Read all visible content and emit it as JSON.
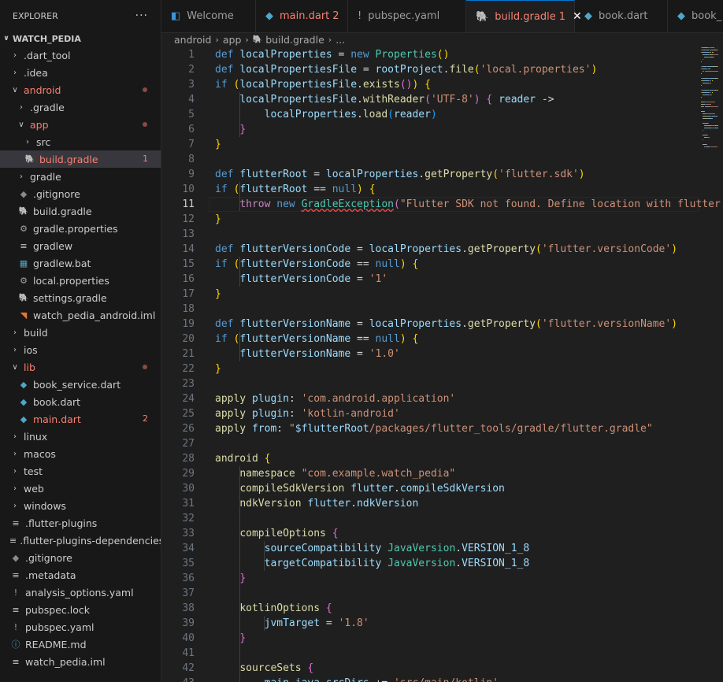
{
  "explorer": {
    "title": "EXPLORER",
    "more": "···",
    "root": "WATCH_PEDIA"
  },
  "tree": [
    {
      "label": ".dart_tool",
      "icon": "chevron-right",
      "level": 1,
      "kind": "folder"
    },
    {
      "label": ".idea",
      "icon": "chevron-right",
      "level": 1,
      "kind": "folder"
    },
    {
      "label": "android",
      "icon": "chevron-down",
      "level": 1,
      "kind": "folder",
      "red": true,
      "dot": true
    },
    {
      "label": ".gradle",
      "icon": "chevron-right",
      "level": 2,
      "kind": "folder"
    },
    {
      "label": "app",
      "icon": "chevron-down",
      "level": 2,
      "kind": "folder",
      "red": true,
      "dot": true
    },
    {
      "label": "src",
      "icon": "chevron-right",
      "level": 3,
      "kind": "folder"
    },
    {
      "label": "build.gradle",
      "icon": "gradle-icon",
      "level": 3,
      "kind": "file",
      "red": true,
      "selected": true,
      "count": "1"
    },
    {
      "label": "gradle",
      "icon": "chevron-right",
      "level": 2,
      "kind": "folder"
    },
    {
      "label": ".gitignore",
      "icon": "git-icon",
      "level": 2,
      "kind": "file"
    },
    {
      "label": "build.gradle",
      "icon": "gradle-icon",
      "level": 2,
      "kind": "file"
    },
    {
      "label": "gradle.properties",
      "icon": "gear-icon",
      "level": 2,
      "kind": "file"
    },
    {
      "label": "gradlew",
      "icon": "lines-icon",
      "level": 2,
      "kind": "file"
    },
    {
      "label": "gradlew.bat",
      "icon": "windows-icon",
      "level": 2,
      "kind": "file"
    },
    {
      "label": "local.properties",
      "icon": "gear-icon",
      "level": 2,
      "kind": "file"
    },
    {
      "label": "settings.gradle",
      "icon": "gradle-icon",
      "level": 2,
      "kind": "file"
    },
    {
      "label": "watch_pedia_android.iml",
      "icon": "rss-icon",
      "level": 2,
      "kind": "file"
    },
    {
      "label": "build",
      "icon": "chevron-right",
      "level": 1,
      "kind": "folder"
    },
    {
      "label": "ios",
      "icon": "chevron-right",
      "level": 1,
      "kind": "folder"
    },
    {
      "label": "lib",
      "icon": "chevron-down",
      "level": 1,
      "kind": "folder",
      "red": true,
      "dot": true
    },
    {
      "label": "book_service.dart",
      "icon": "dart-icon",
      "level": 2,
      "kind": "file"
    },
    {
      "label": "book.dart",
      "icon": "dart-icon",
      "level": 2,
      "kind": "file"
    },
    {
      "label": "main.dart",
      "icon": "dart-icon",
      "level": 2,
      "kind": "file",
      "red": true,
      "count": "2"
    },
    {
      "label": "linux",
      "icon": "chevron-right",
      "level": 1,
      "kind": "folder"
    },
    {
      "label": "macos",
      "icon": "chevron-right",
      "level": 1,
      "kind": "folder"
    },
    {
      "label": "test",
      "icon": "chevron-right",
      "level": 1,
      "kind": "folder"
    },
    {
      "label": "web",
      "icon": "chevron-right",
      "level": 1,
      "kind": "folder"
    },
    {
      "label": "windows",
      "icon": "chevron-right",
      "level": 1,
      "kind": "folder"
    },
    {
      "label": ".flutter-plugins",
      "icon": "lines-icon",
      "level": 1,
      "kind": "file"
    },
    {
      "label": ".flutter-plugins-dependencies",
      "icon": "lines-icon",
      "level": 1,
      "kind": "file"
    },
    {
      "label": ".gitignore",
      "icon": "git-icon",
      "level": 1,
      "kind": "file"
    },
    {
      "label": ".metadata",
      "icon": "lines-icon",
      "level": 1,
      "kind": "file"
    },
    {
      "label": "analysis_options.yaml",
      "icon": "exclamation-icon",
      "level": 1,
      "kind": "file"
    },
    {
      "label": "pubspec.lock",
      "icon": "lines-icon",
      "level": 1,
      "kind": "file"
    },
    {
      "label": "pubspec.yaml",
      "icon": "exclamation-icon",
      "level": 1,
      "kind": "file"
    },
    {
      "label": "README.md",
      "icon": "info-icon",
      "level": 1,
      "kind": "file"
    },
    {
      "label": "watch_pedia.iml",
      "icon": "lines-icon",
      "level": 1,
      "kind": "file"
    }
  ],
  "tabs": [
    {
      "label": "Welcome",
      "icon": "vscode-icon"
    },
    {
      "label": "main.dart",
      "icon": "dart-icon",
      "badge": "2",
      "red": true
    },
    {
      "label": "pubspec.yaml",
      "icon": "exclamation-icon"
    },
    {
      "label": "build.gradle",
      "icon": "gradle-icon",
      "badge": "1",
      "red": true,
      "active": true,
      "close": "✕"
    },
    {
      "label": "book.dart",
      "icon": "dart-icon"
    },
    {
      "label": "book_",
      "icon": "dart-icon"
    }
  ],
  "breadcrumb": [
    "android",
    "app",
    "build.gradle",
    "..."
  ],
  "editor": {
    "current_line": 11,
    "lines": [
      [
        [
          "kw",
          "def "
        ],
        [
          "var",
          "localProperties"
        ],
        [
          "pl",
          " = "
        ],
        [
          "kw",
          "new "
        ],
        [
          "ty",
          "Properties"
        ],
        [
          "b1",
          "()"
        ]
      ],
      [
        [
          "kw",
          "def "
        ],
        [
          "var",
          "localPropertiesFile"
        ],
        [
          "pl",
          " = "
        ],
        [
          "var",
          "rootProject"
        ],
        [
          "pl",
          "."
        ],
        [
          "fn",
          "file"
        ],
        [
          "b1",
          "("
        ],
        [
          "str",
          "'local.properties'"
        ],
        [
          "b1",
          ")"
        ]
      ],
      [
        [
          "kw",
          "if "
        ],
        [
          "b1",
          "("
        ],
        [
          "var",
          "localPropertiesFile"
        ],
        [
          "pl",
          "."
        ],
        [
          "fn",
          "exists"
        ],
        [
          "b2",
          "()"
        ],
        [
          "b1",
          ")"
        ],
        [
          "pl",
          " "
        ],
        [
          "b1",
          "{"
        ]
      ],
      [
        [
          "pl",
          "    "
        ],
        [
          "var",
          "localPropertiesFile"
        ],
        [
          "pl",
          "."
        ],
        [
          "fn",
          "withReader"
        ],
        [
          "b2",
          "("
        ],
        [
          "str",
          "'UTF-8'"
        ],
        [
          "b2",
          ")"
        ],
        [
          "pl",
          " "
        ],
        [
          "b2",
          "{"
        ],
        [
          "pl",
          " "
        ],
        [
          "var",
          "reader"
        ],
        [
          "pl",
          " ->"
        ]
      ],
      [
        [
          "pl",
          "        "
        ],
        [
          "var",
          "localProperties"
        ],
        [
          "pl",
          "."
        ],
        [
          "fn",
          "load"
        ],
        [
          "b3",
          "("
        ],
        [
          "var",
          "reader"
        ],
        [
          "b3",
          ")"
        ]
      ],
      [
        [
          "pl",
          "    "
        ],
        [
          "b2",
          "}"
        ]
      ],
      [
        [
          "b1",
          "}"
        ]
      ],
      [],
      [
        [
          "kw",
          "def "
        ],
        [
          "var",
          "flutterRoot"
        ],
        [
          "pl",
          " = "
        ],
        [
          "var",
          "localProperties"
        ],
        [
          "pl",
          "."
        ],
        [
          "fn",
          "getProperty"
        ],
        [
          "b1",
          "("
        ],
        [
          "str",
          "'flutter.sdk'"
        ],
        [
          "b1",
          ")"
        ]
      ],
      [
        [
          "kw",
          "if "
        ],
        [
          "b1",
          "("
        ],
        [
          "var",
          "flutterRoot"
        ],
        [
          "pl",
          " == "
        ],
        [
          "kw",
          "null"
        ],
        [
          "b1",
          ")"
        ],
        [
          "pl",
          " "
        ],
        [
          "b1",
          "{"
        ]
      ],
      [
        [
          "pl",
          "    "
        ],
        [
          "ctl",
          "throw "
        ],
        [
          "kw",
          "new "
        ],
        [
          "err",
          "GradleException"
        ],
        [
          "b2",
          "("
        ],
        [
          "str",
          "\"Flutter SDK not found. Define location with flutter.sdk in the local.properties file.\""
        ],
        [
          "b2",
          ")"
        ]
      ],
      [
        [
          "b1",
          "}"
        ]
      ],
      [],
      [
        [
          "kw",
          "def "
        ],
        [
          "var",
          "flutterVersionCode"
        ],
        [
          "pl",
          " = "
        ],
        [
          "var",
          "localProperties"
        ],
        [
          "pl",
          "."
        ],
        [
          "fn",
          "getProperty"
        ],
        [
          "b1",
          "("
        ],
        [
          "str",
          "'flutter.versionCode'"
        ],
        [
          "b1",
          ")"
        ]
      ],
      [
        [
          "kw",
          "if "
        ],
        [
          "b1",
          "("
        ],
        [
          "var",
          "flutterVersionCode"
        ],
        [
          "pl",
          " == "
        ],
        [
          "kw",
          "null"
        ],
        [
          "b1",
          ")"
        ],
        [
          "pl",
          " "
        ],
        [
          "b1",
          "{"
        ]
      ],
      [
        [
          "pl",
          "    "
        ],
        [
          "var",
          "flutterVersionCode"
        ],
        [
          "pl",
          " = "
        ],
        [
          "str",
          "'1'"
        ]
      ],
      [
        [
          "b1",
          "}"
        ]
      ],
      [],
      [
        [
          "kw",
          "def "
        ],
        [
          "var",
          "flutterVersionName"
        ],
        [
          "pl",
          " = "
        ],
        [
          "var",
          "localProperties"
        ],
        [
          "pl",
          "."
        ],
        [
          "fn",
          "getProperty"
        ],
        [
          "b1",
          "("
        ],
        [
          "str",
          "'flutter.versionName'"
        ],
        [
          "b1",
          ")"
        ]
      ],
      [
        [
          "kw",
          "if "
        ],
        [
          "b1",
          "("
        ],
        [
          "var",
          "flutterVersionName"
        ],
        [
          "pl",
          " == "
        ],
        [
          "kw",
          "null"
        ],
        [
          "b1",
          ")"
        ],
        [
          "pl",
          " "
        ],
        [
          "b1",
          "{"
        ]
      ],
      [
        [
          "pl",
          "    "
        ],
        [
          "var",
          "flutterVersionName"
        ],
        [
          "pl",
          " = "
        ],
        [
          "str",
          "'1.0'"
        ]
      ],
      [
        [
          "b1",
          "}"
        ]
      ],
      [],
      [
        [
          "fn",
          "apply "
        ],
        [
          "var",
          "plugin"
        ],
        [
          "pl",
          ": "
        ],
        [
          "str",
          "'com.android.application'"
        ]
      ],
      [
        [
          "fn",
          "apply "
        ],
        [
          "var",
          "plugin"
        ],
        [
          "pl",
          ": "
        ],
        [
          "str",
          "'kotlin-android'"
        ]
      ],
      [
        [
          "fn",
          "apply "
        ],
        [
          "var",
          "from"
        ],
        [
          "pl",
          ": "
        ],
        [
          "str",
          "\""
        ],
        [
          "var",
          "$flutterRoot"
        ],
        [
          "str",
          "/packages/flutter_tools/gradle/flutter.gradle\""
        ]
      ],
      [],
      [
        [
          "fn",
          "android "
        ],
        [
          "b1",
          "{"
        ]
      ],
      [
        [
          "pl",
          "    "
        ],
        [
          "fn",
          "namespace "
        ],
        [
          "str",
          "\"com.example.watch_pedia\""
        ]
      ],
      [
        [
          "pl",
          "    "
        ],
        [
          "fn",
          "compileSdkVersion "
        ],
        [
          "var",
          "flutter"
        ],
        [
          "pl",
          "."
        ],
        [
          "var",
          "compileSdkVersion"
        ]
      ],
      [
        [
          "pl",
          "    "
        ],
        [
          "fn",
          "ndkVersion "
        ],
        [
          "var",
          "flutter"
        ],
        [
          "pl",
          "."
        ],
        [
          "var",
          "ndkVersion"
        ]
      ],
      [],
      [
        [
          "pl",
          "    "
        ],
        [
          "fn",
          "compileOptions "
        ],
        [
          "b2",
          "{"
        ]
      ],
      [
        [
          "pl",
          "        "
        ],
        [
          "var",
          "sourceCompatibility "
        ],
        [
          "ty",
          "JavaVersion"
        ],
        [
          "pl",
          "."
        ],
        [
          "var",
          "VERSION_1_8"
        ]
      ],
      [
        [
          "pl",
          "        "
        ],
        [
          "var",
          "targetCompatibility "
        ],
        [
          "ty",
          "JavaVersion"
        ],
        [
          "pl",
          "."
        ],
        [
          "var",
          "VERSION_1_8"
        ]
      ],
      [
        [
          "pl",
          "    "
        ],
        [
          "b2",
          "}"
        ]
      ],
      [],
      [
        [
          "pl",
          "    "
        ],
        [
          "fn",
          "kotlinOptions "
        ],
        [
          "b2",
          "{"
        ]
      ],
      [
        [
          "pl",
          "        "
        ],
        [
          "var",
          "jvmTarget"
        ],
        [
          "pl",
          " = "
        ],
        [
          "str",
          "'1.8'"
        ]
      ],
      [
        [
          "pl",
          "    "
        ],
        [
          "b2",
          "}"
        ]
      ],
      [],
      [
        [
          "pl",
          "    "
        ],
        [
          "fn",
          "sourceSets "
        ],
        [
          "b2",
          "{"
        ]
      ],
      [
        [
          "pl",
          "        "
        ],
        [
          "var",
          "main"
        ],
        [
          "pl",
          "."
        ],
        [
          "var",
          "java"
        ],
        [
          "pl",
          "."
        ],
        [
          "var",
          "srcDirs"
        ],
        [
          "pl",
          " += "
        ],
        [
          "str",
          "'src/main/kotlin'"
        ]
      ]
    ]
  },
  "colors": {
    "accent": "#0078d4",
    "error": "#f88070",
    "sidebar": "#181818",
    "editor": "#1f1f1f"
  }
}
